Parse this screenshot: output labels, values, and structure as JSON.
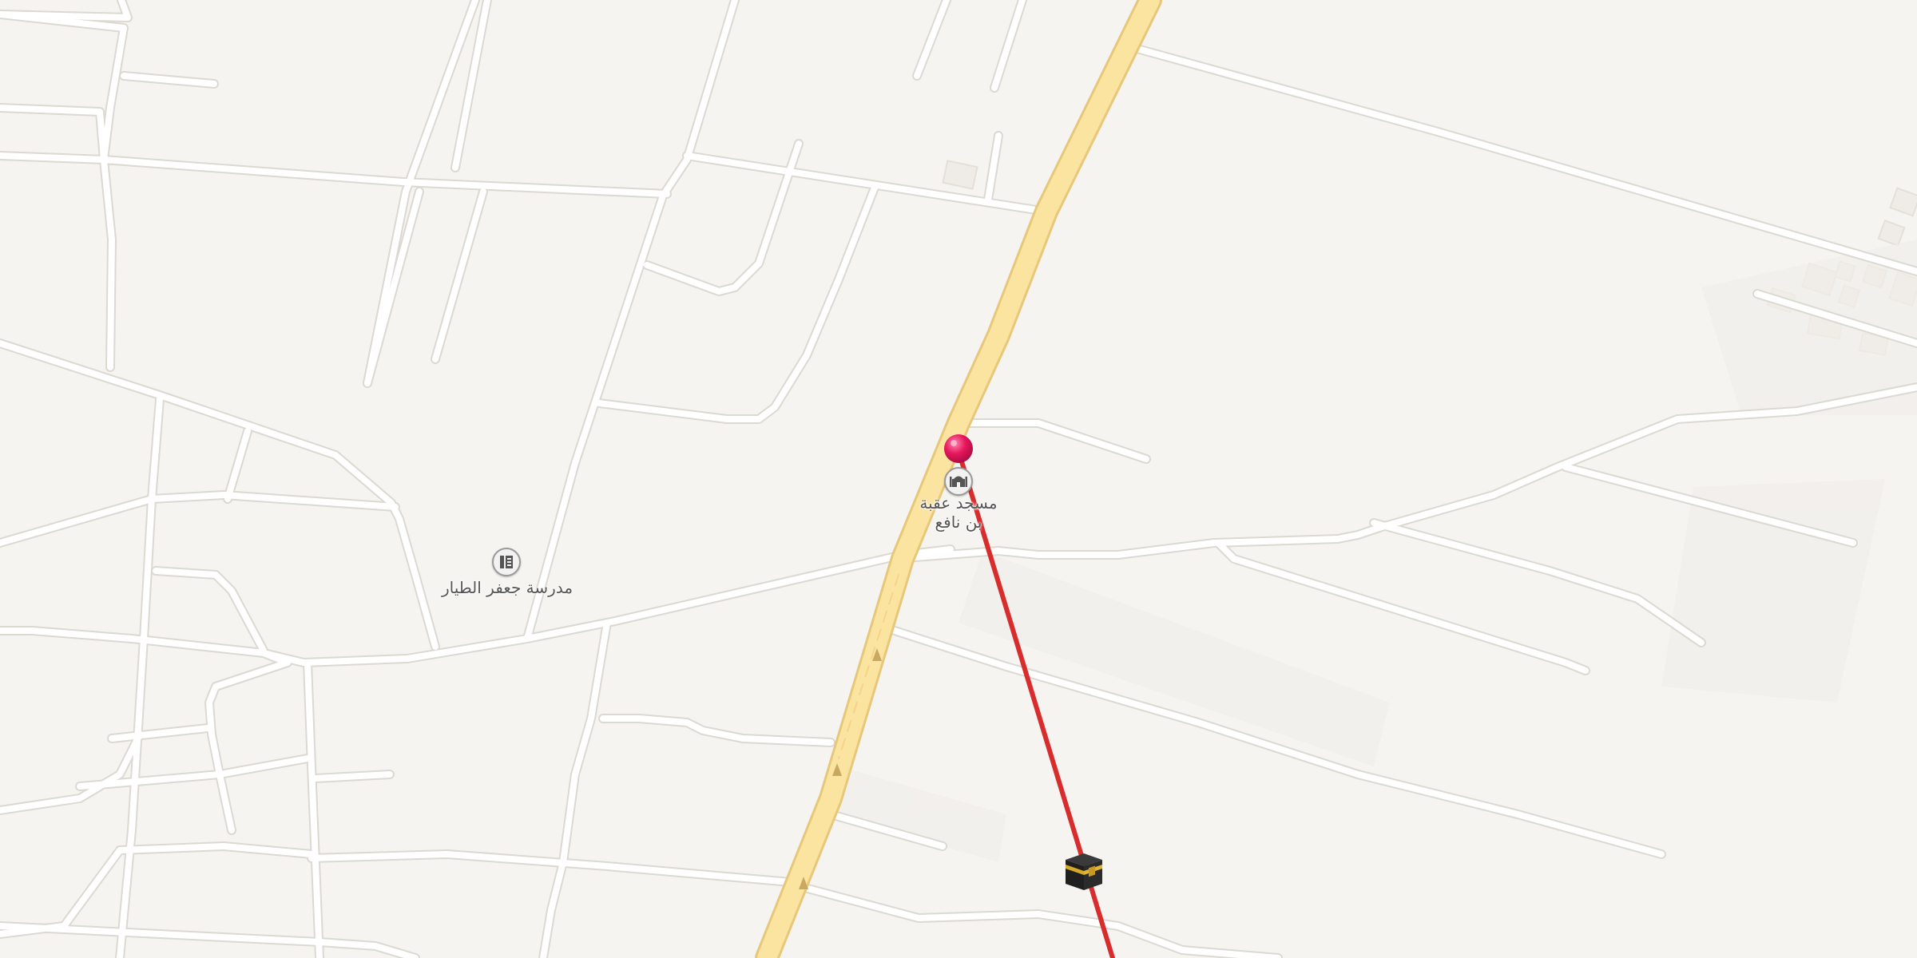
{
  "map": {
    "background_color": "#f6f4f1",
    "road_color": "#ffffff",
    "main_road_color": "#fbe3a0",
    "direction_line_color": "#d92c2c"
  },
  "places": {
    "school": {
      "name": "مدرسة جعفر الطيار",
      "icon": "school-icon"
    },
    "mosque": {
      "name_line1": "مسجد عقبة",
      "name_line2": "بن نافع",
      "icon": "mosque-icon"
    }
  },
  "markers": {
    "location_pin": {
      "icon": "pin-icon",
      "color": "#e8175d"
    },
    "qibla": {
      "icon": "kaaba-icon"
    }
  }
}
